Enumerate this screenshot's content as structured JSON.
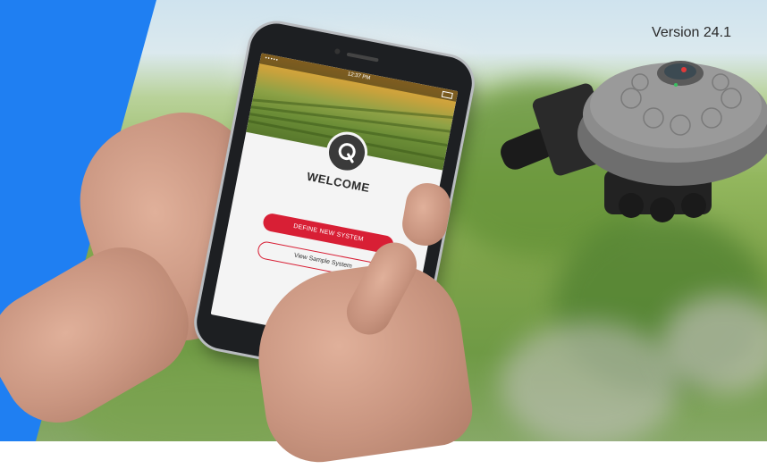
{
  "version_label": "Version 24.1",
  "phone": {
    "status_time": "12:37 PM",
    "status_signal": "•••••",
    "welcome_title": "WELCOME",
    "primary_button": "DEFINE NEW SYSTEM",
    "secondary_button": "View Sample System"
  },
  "colors": {
    "brand_blue": "#1f7ff2",
    "accent_red": "#d81f35",
    "logo_dark": "#3a3a3a"
  },
  "icons": [
    "leaf-logo-icon",
    "home-button-icon"
  ]
}
